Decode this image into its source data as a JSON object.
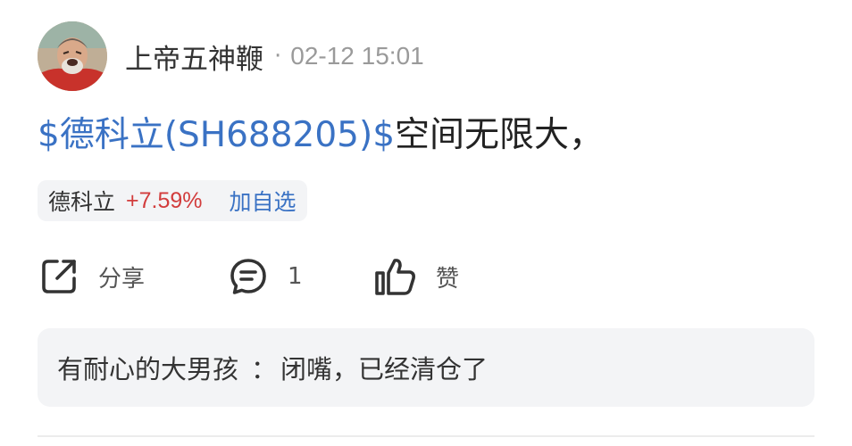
{
  "post": {
    "author": {
      "name": "上帝五神鞭"
    },
    "separator": "·",
    "timestamp": "02-12 15:01",
    "content": {
      "stock_link": "$德科立(SH688205)$",
      "text": "空间无限大，"
    },
    "stock_chip": {
      "name": "德科立",
      "change": "+7.59%",
      "add_label": "加自选"
    },
    "actions": {
      "share_label": "分享",
      "comment_count": "1",
      "like_label": "赞"
    },
    "top_comment": {
      "author": "有耐心的大男孩",
      "colon": "：",
      "text": "闭嘴，已经清仓了"
    }
  },
  "colors": {
    "link": "#3a72c4",
    "up": "#d23c3c",
    "chip_bg": "#f3f4f6",
    "meta": "#9a9a9a"
  },
  "icons": {
    "share": "share-out-icon",
    "comment": "comment-bubble-icon",
    "like": "thumbs-up-icon"
  }
}
